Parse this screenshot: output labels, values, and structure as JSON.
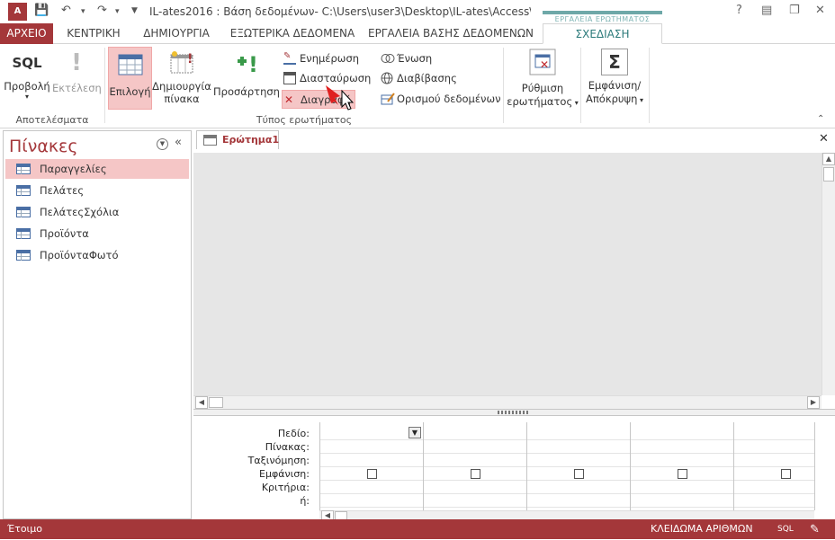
{
  "app": {
    "icon_label": "A",
    "title": "IL-ates2016 : Βάση δεδομένων- C:\\Users\\user3\\Desktop\\IL-ates\\Access\\IL-ates...",
    "context_header": "ΕΡΓΑΛΕΙΑ ΕΡΩΤΗΜΑΤΟΣ"
  },
  "window_controls": {
    "help": "?",
    "minimize": "—",
    "restore": "❐",
    "close": "✕"
  },
  "tabs": [
    {
      "label": "ΑΡΧΕΙΟ"
    },
    {
      "label": "ΚΕΝΤΡΙΚΗ"
    },
    {
      "label": "ΔΗΜΙΟΥΡΓΙΑ"
    },
    {
      "label": "ΕΞΩΤΕΡΙΚΑ ΔΕΔΟΜΕΝΑ"
    },
    {
      "label": "ΕΡΓΑΛΕΙΑ ΒΑΣΗΣ ΔΕΔΟΜΕΝΩΝ"
    },
    {
      "label": "ΣΧΕΔΙΑΣΗ"
    }
  ],
  "ribbon": {
    "results": {
      "view_icon": "SQL",
      "view_label": "Προβολή",
      "run_icon": "!",
      "run_label": "Εκτέλεση",
      "group_label": "Αποτελέσματα"
    },
    "query_type": {
      "select_label": "Επιλογή",
      "make_table_label": "Δημιουργία πίνακα",
      "append_label": "Προσάρτηση",
      "update_label": "Ενημέρωση",
      "crosstab_label": "Διασταύρωση",
      "delete_label": "Διαγραφή",
      "union_label": "Ένωση",
      "passthrough_label": "Διαβίβασης",
      "data_definition_label": "Ορισμού δεδομένων",
      "group_label": "Τύπος ερωτήματος"
    },
    "setup": {
      "label_line1": "Ρύθμιση",
      "label_line2": "ερωτήματος"
    },
    "show_hide": {
      "icon": "Σ",
      "label_line1": "Εμφάνιση/",
      "label_line2": "Απόκρυψη"
    }
  },
  "nav_pane": {
    "title": "Πίνακες",
    "items": [
      {
        "label": "Παραγγελίες",
        "selected": true
      },
      {
        "label": "Πελάτες",
        "selected": false
      },
      {
        "label": "ΠελάτεςΣχόλια",
        "selected": false
      },
      {
        "label": "Προϊόντα",
        "selected": false
      },
      {
        "label": "ΠροϊόνταΦωτό",
        "selected": false
      }
    ]
  },
  "document": {
    "tab_label": "Ερώτημα1",
    "grid_row_labels": [
      "Πεδίο:",
      "Πίνακας:",
      "Ταξινόμηση:",
      "Εμφάνιση:",
      "Κριτήρια:",
      "ή:"
    ]
  },
  "statusbar": {
    "left": "Έτοιμο",
    "numlock": "ΚΛΕΙΔΩΜΑ ΑΡΙΘΜΩΝ",
    "sql": "SQL"
  },
  "colors": {
    "accent": "#a4373a",
    "selected_bg": "#f5c6c6",
    "context_tab": "#2b7a7a"
  }
}
